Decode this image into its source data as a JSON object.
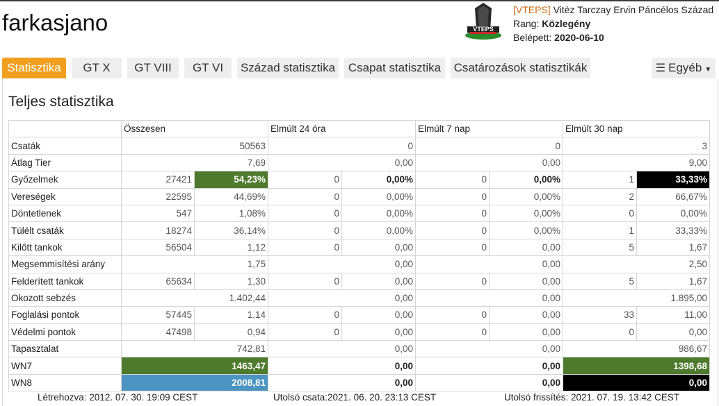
{
  "player": {
    "name": "farkasjano"
  },
  "clan": {
    "tag": "[VTEPS]",
    "name": "Vitéz Tarczay Ervin Páncélos Század",
    "rank_label": "Rang:",
    "rank": "Közlegény",
    "joined_label": "Belépett:",
    "joined": "2020-06-10",
    "logo_text": "VTEPS"
  },
  "tabs": [
    {
      "label": "Statisztika",
      "active": true
    },
    {
      "label": "GT X"
    },
    {
      "label": "GT VIII"
    },
    {
      "label": "GT VI"
    },
    {
      "label": "Század statisztika"
    },
    {
      "label": "Csapat statisztika"
    },
    {
      "label": "Csatározások statisztikák"
    }
  ],
  "more_menu": {
    "label": "Egyéb",
    "icon": "menu-icon"
  },
  "section": {
    "title": "Teljes statisztika"
  },
  "table": {
    "headers": [
      "Összesen",
      "Elmúlt 24 óra",
      "Elmúlt 7 nap",
      "Elmúlt 30 nap"
    ],
    "rows": [
      {
        "label": "Csaták",
        "cells": [
          "50563",
          "0",
          "0",
          "3"
        ]
      },
      {
        "label": "Átlag Tier",
        "cells": [
          "7,69",
          "0,00",
          "0,00",
          "9,00"
        ]
      },
      {
        "label": "Győzelmek",
        "cells": [
          "27421",
          "54,23%",
          "0",
          "0,00%",
          "0",
          "0,00%",
          "1",
          "33,33%"
        ]
      },
      {
        "label": "Vereségek",
        "cells": [
          "22595",
          "44,69%",
          "0",
          "0,00%",
          "0",
          "0,00%",
          "2",
          "66,67%"
        ]
      },
      {
        "label": "Döntetlenek",
        "cells": [
          "547",
          "1,08%",
          "0",
          "0,00%",
          "0",
          "0,00%",
          "0",
          "0,00%"
        ]
      },
      {
        "label": "Túlélt csaták",
        "cells": [
          "18274",
          "36,14%",
          "0",
          "0,00%",
          "0",
          "0,00%",
          "1",
          "33,33%"
        ]
      },
      {
        "label": "Kilőtt tankok",
        "cells": [
          "56504",
          "1,12",
          "0",
          "0,00",
          "0",
          "0,00",
          "5",
          "1,67"
        ]
      },
      {
        "label": "Megsemmisítési arány",
        "cells": [
          "1,75",
          "0,00",
          "0,00",
          "2,50"
        ]
      },
      {
        "label": "Felderített tankok",
        "cells": [
          "65634",
          "1,30",
          "0",
          "0,00",
          "0",
          "0,00",
          "5",
          "1,67"
        ]
      },
      {
        "label": "Okozott sebzés",
        "cells": [
          "1.402,44",
          "0,00",
          "0,00",
          "1.895,00"
        ]
      },
      {
        "label": "Foglalási pontok",
        "cells": [
          "57445",
          "1,14",
          "0",
          "0,00",
          "0",
          "0,00",
          "33",
          "11,00"
        ]
      },
      {
        "label": "Védelmi pontok",
        "cells": [
          "47498",
          "0,94",
          "0",
          "0,00",
          "0",
          "0,00",
          "0",
          "0,00"
        ]
      },
      {
        "label": "Tapasztalat",
        "cells": [
          "742,81",
          "0,00",
          "0,00",
          "986,67"
        ]
      },
      {
        "label": "WN7",
        "cells": [
          "1463,47",
          "0,00",
          "0,00",
          "1398,68"
        ]
      },
      {
        "label": "WN8",
        "cells": [
          "2008,81",
          "0,00",
          "0,00",
          "0,00"
        ]
      }
    ]
  },
  "footer": {
    "created": "Létrehozva: 2012. 07. 30. 19:09 CEST",
    "last_battle": "Utolsó csata:2021. 06. 20. 23:13 CEST",
    "last_refresh": "Utolsó frissítés: 2021. 07. 19. 13:42 CEST"
  },
  "colors": {
    "accent": "#f0a01e",
    "good": "#4d7a2c",
    "unicum": "#4b93c0",
    "bad": "#000000"
  }
}
